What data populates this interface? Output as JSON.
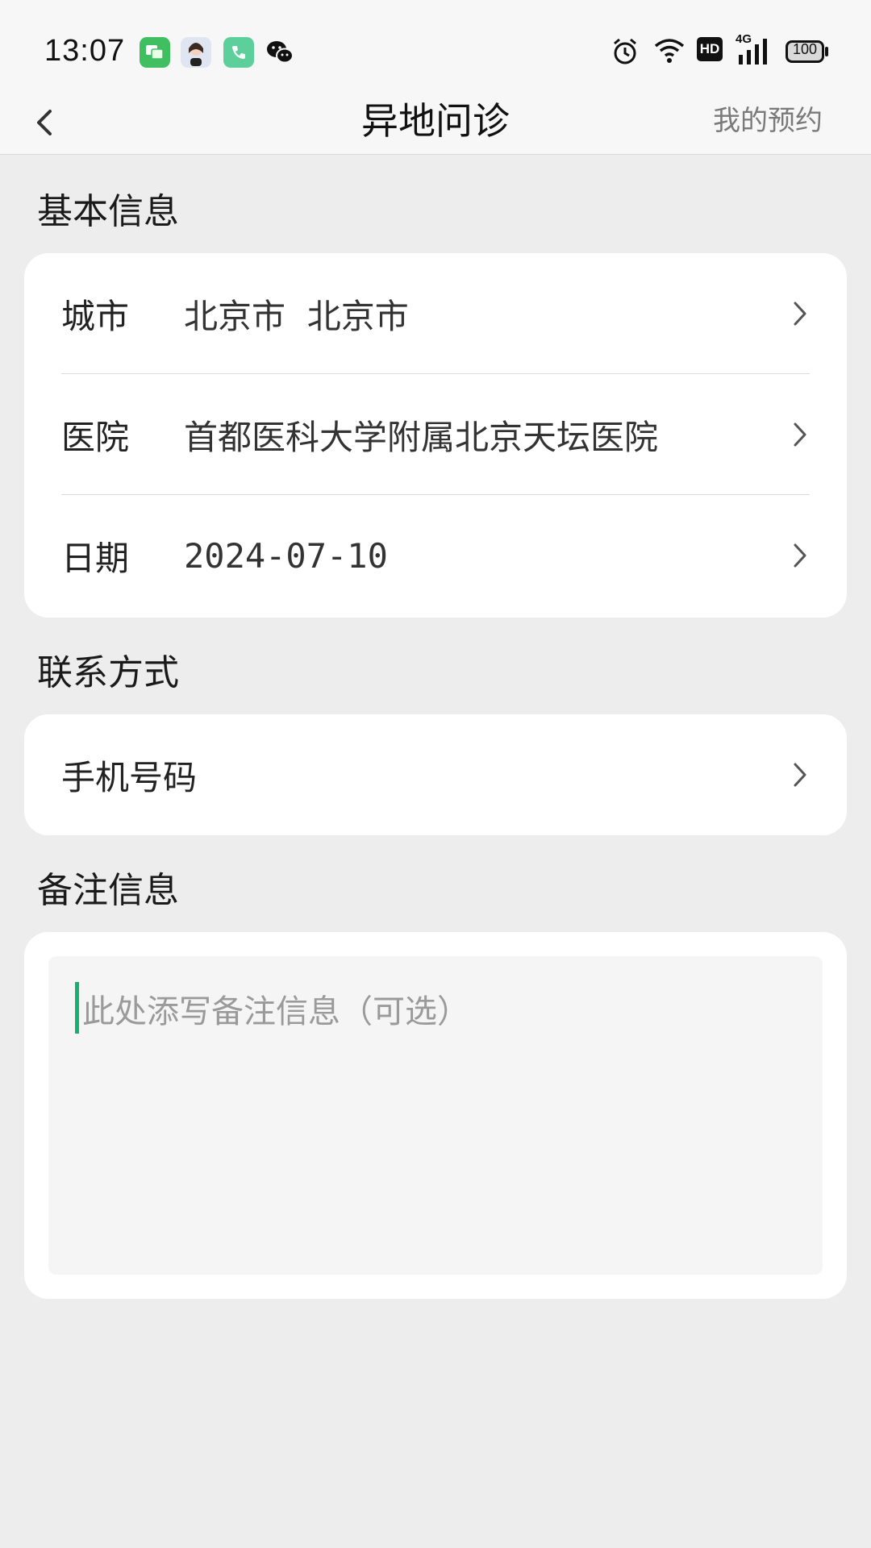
{
  "status_bar": {
    "time": "13:07",
    "battery": "100",
    "network": "4G",
    "hd": "HD",
    "icons": [
      "messages-icon",
      "avatar-icon",
      "phone-icon",
      "wechat-icon",
      "alarm-icon",
      "wifi-icon",
      "hd-icon",
      "signal-icon",
      "battery-icon"
    ]
  },
  "nav": {
    "title": "异地问诊",
    "right_link": "我的预约"
  },
  "basic_info": {
    "section_title": "基本信息",
    "rows": [
      {
        "label": "城市",
        "value": "北京市  北京市"
      },
      {
        "label": "医院",
        "value": "首都医科大学附属北京天坛医院"
      },
      {
        "label": "日期",
        "value": "2024-07-10"
      }
    ]
  },
  "contact": {
    "section_title": "联系方式",
    "phone_label": "手机号码"
  },
  "remarks": {
    "section_title": "备注信息",
    "placeholder": "此处添写备注信息（可选）"
  },
  "colors": {
    "accent": "#1aad74",
    "background": "#ededed",
    "card": "#ffffff"
  }
}
